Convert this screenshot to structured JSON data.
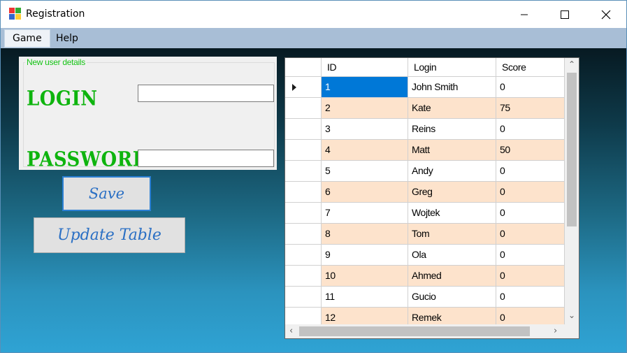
{
  "window": {
    "title": "Registration"
  },
  "menu": {
    "items": [
      "Game",
      "Help"
    ]
  },
  "form": {
    "group_title": "New user details",
    "login_label": "LOGIN",
    "password_label": "PASSWORD",
    "login_value": "",
    "password_value": "",
    "save_label": "Save",
    "update_label": "Update Table"
  },
  "table": {
    "columns": [
      "ID",
      "Login",
      "Score"
    ],
    "current_row": 0,
    "rows": [
      [
        "1",
        "John Smith",
        "0"
      ],
      [
        "2",
        "Kate",
        "75"
      ],
      [
        "3",
        "Reins",
        "0"
      ],
      [
        "4",
        "Matt",
        "50"
      ],
      [
        "5",
        "Andy",
        "0"
      ],
      [
        "6",
        "Greg",
        "0"
      ],
      [
        "7",
        "Wojtek",
        "0"
      ],
      [
        "8",
        "Tom",
        "0"
      ],
      [
        "9",
        "Ola",
        "0"
      ],
      [
        "10",
        "Ahmed",
        "0"
      ],
      [
        "11",
        "Gucio",
        "0"
      ],
      [
        "12",
        "Remek",
        "0"
      ]
    ]
  },
  "colors": {
    "selected_cell": "#0078d7",
    "alt_row": "#fde3cc",
    "label_green": "#0eb40e",
    "button_text": "#2a6fc4"
  }
}
